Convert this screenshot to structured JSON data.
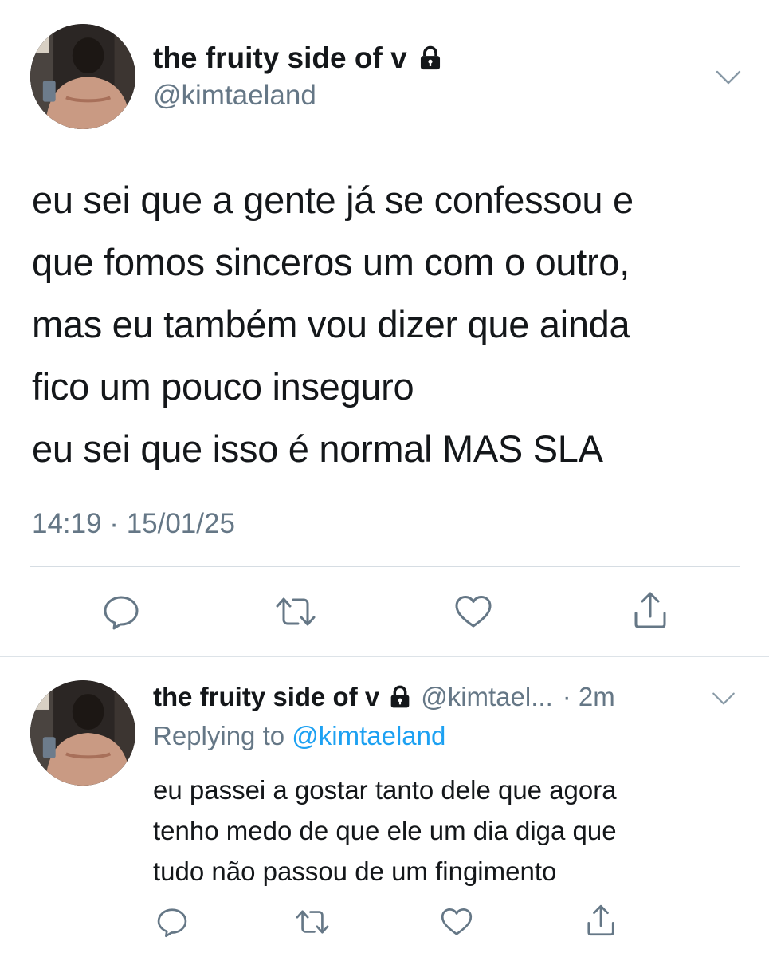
{
  "main_tweet": {
    "display_name": "the fruity side of v",
    "handle": "@kimtaeland",
    "text": "eu sei que a gente já se confessou e\nque fomos sinceros um com o outro,\nmas eu também vou dizer que ainda\nfico um pouco inseguro\neu sei que isso é normal MAS SLA",
    "timestamp": "14:19 · 15/01/25",
    "protected_icon": "lock-icon",
    "menu_icon": "chevron-down-icon",
    "actions": [
      "reply-icon",
      "retweet-icon",
      "like-icon",
      "share-icon"
    ]
  },
  "reply_tweet": {
    "display_name": "the fruity side of v",
    "handle": "@kimtael...",
    "time": "· 2m",
    "replying_prefix": "Replying to",
    "replying_to": "@kimtaeland",
    "text": "eu passei a gostar tanto dele que agora\ntenho medo de que ele um dia diga que\ntudo não passou de um fingimento",
    "protected_icon": "lock-icon",
    "menu_icon": "chevron-down-icon",
    "actions": [
      "reply-icon",
      "retweet-icon",
      "like-icon",
      "share-icon"
    ]
  },
  "colors": {
    "text_primary": "#14171a",
    "text_secondary": "#657786",
    "link": "#1da1f2",
    "divider": "#d6dde3",
    "background": "#ffffff"
  }
}
